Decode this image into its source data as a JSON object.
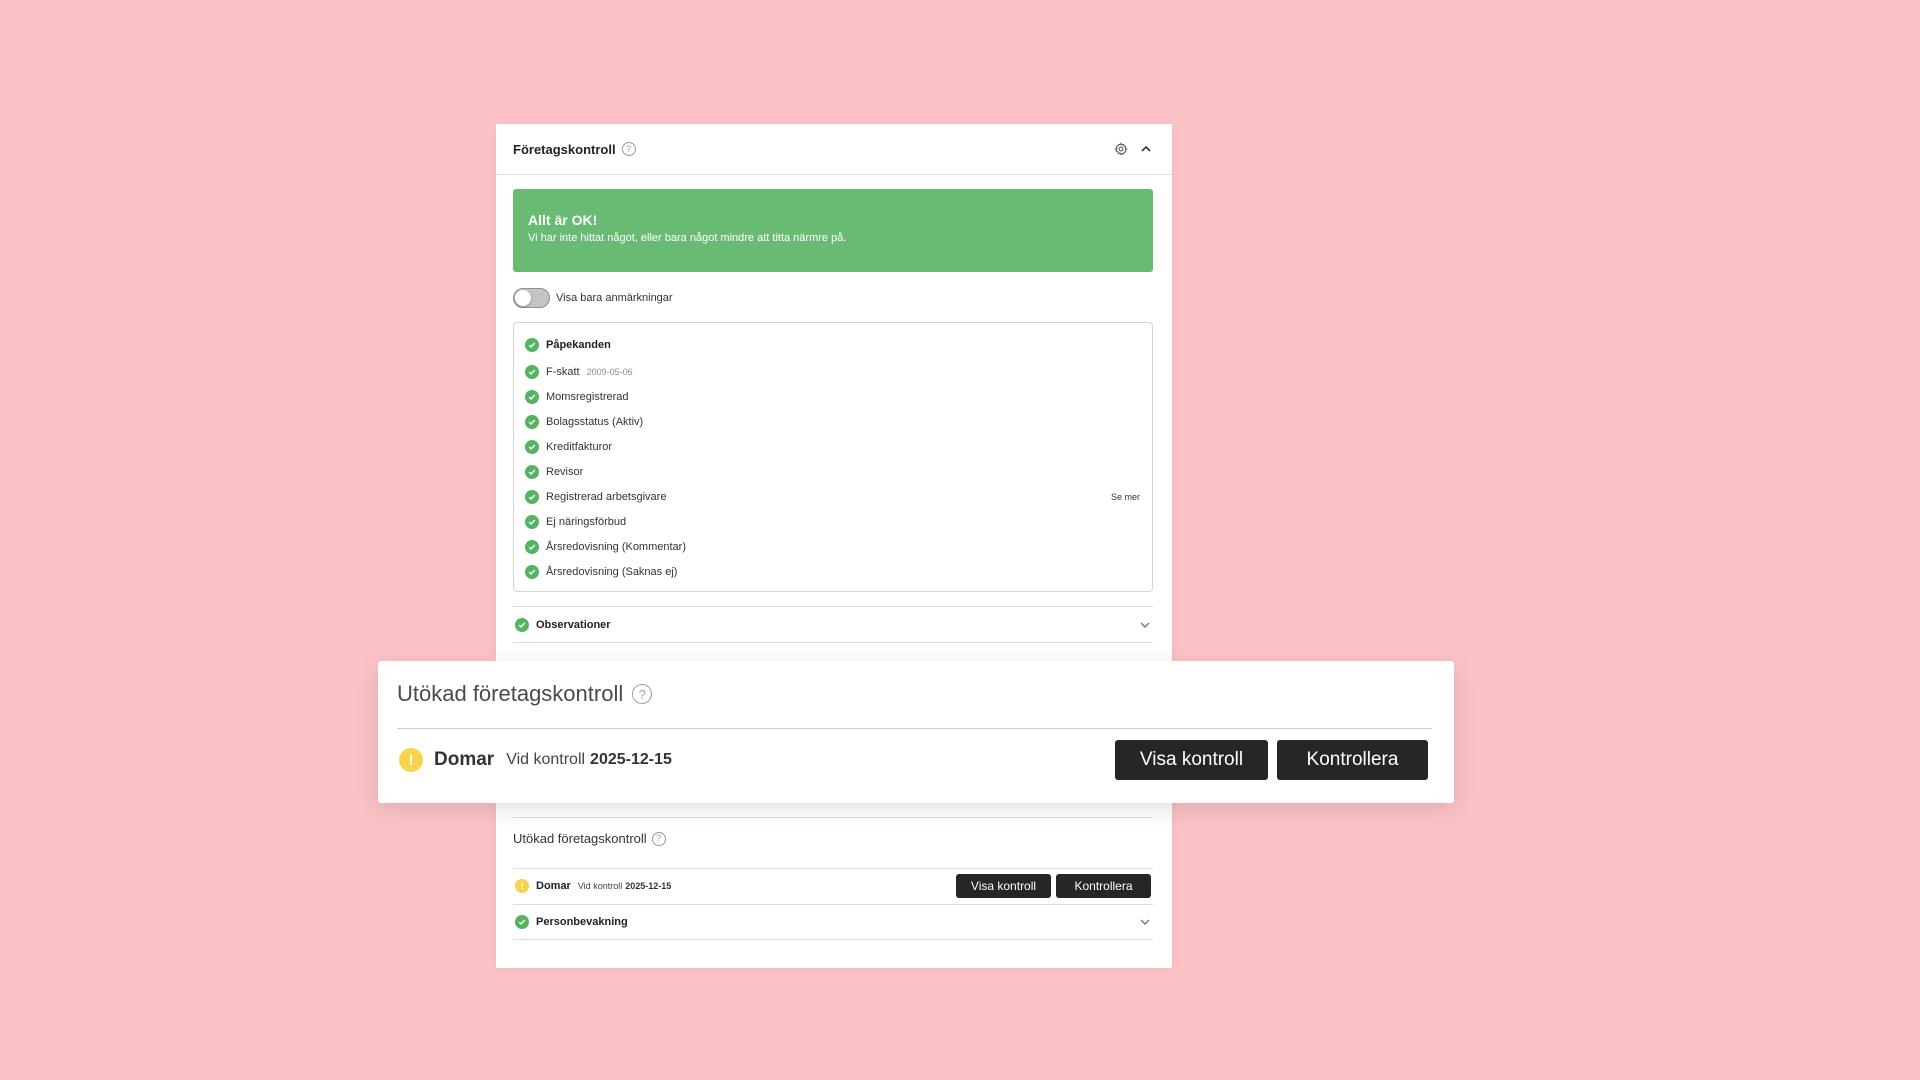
{
  "panel": {
    "title": "Företagskontroll",
    "help_glyph": "?",
    "icons": {
      "settings": "gear-icon",
      "collapse": "chevron-up-icon"
    }
  },
  "banner": {
    "title": "Allt är OK!",
    "text": "Vi har inte hittat något, eller bara något mindre att titta närmre på.",
    "color": "#69bb74"
  },
  "toggle": {
    "label": "Visa bara anmärkningar",
    "checked": false
  },
  "checks": {
    "heading": "Påpekanden",
    "items": [
      {
        "label": "F-skatt",
        "date": "2009-05-06"
      },
      {
        "label": "Momsregistrerad"
      },
      {
        "label": "Bolagsstatus (Aktiv)"
      },
      {
        "label": "Kreditfakturor"
      },
      {
        "label": "Revisor"
      },
      {
        "label": "Registrerad arbetsgivare",
        "link": "Se mer"
      },
      {
        "label": "Ej näringsförbud"
      },
      {
        "label": "Årsredovisning (Kommentar)"
      },
      {
        "label": "Årsredovisning (Saknas ej)"
      }
    ]
  },
  "sections": {
    "observationer": "Observationer"
  },
  "utokad": {
    "title": "Utökad företagskontroll",
    "item_name": "Domar",
    "checked_label": "Vid kontroll",
    "checked_date": "2025-12-15",
    "show_button": "Visa kontroll",
    "check_button": "Kontrollera",
    "warning_glyph": "!"
  },
  "personbevakning": "Personbevakning",
  "colors": {
    "accent_green": "#55b462",
    "warning": "#f7d44c",
    "background": "#fcc3c6",
    "button": "#262626"
  }
}
